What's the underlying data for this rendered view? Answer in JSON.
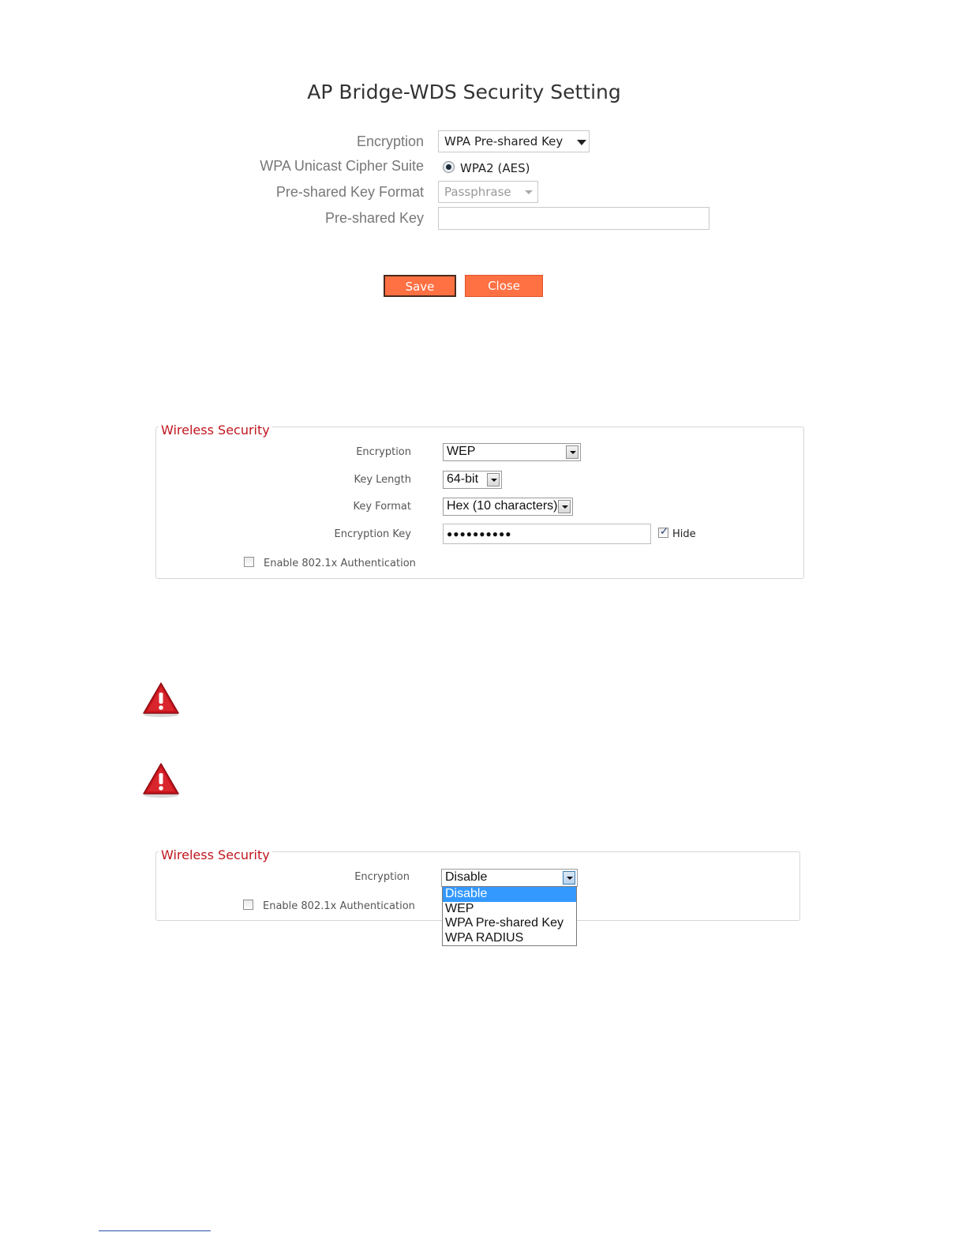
{
  "panel1": {
    "title": "AP Bridge-WDS Security Setting",
    "encryption_label": "Encryption",
    "encryption_value": "WPA Pre-shared Key",
    "cipher_label": "WPA Unicast Cipher Suite",
    "cipher_option": "WPA2 (AES)",
    "key_format_label": "Pre-shared Key Format",
    "key_format_value": "Passphrase",
    "key_label": "Pre-shared Key",
    "key_value": "",
    "save_label": "Save",
    "close_label": "Close"
  },
  "panel2": {
    "legend": "Wireless  Security",
    "encryption_label": "Encryption",
    "encryption_value": "WEP",
    "key_length_label": "Key Length",
    "key_length_value": "64-bit",
    "key_format_label": "Key Format",
    "key_format_value": "Hex (10 characters)",
    "encryption_key_label": "Encryption Key",
    "encryption_key_value": "●●●●●●●●●●",
    "hide_label": "Hide",
    "hide_checked": true,
    "auth_label": "Enable 802.1x Authentication",
    "auth_checked": false
  },
  "panel3": {
    "legend": "Wireless  Security",
    "encryption_label": "Encryption",
    "encryption_value": "Disable",
    "options": [
      "Disable",
      "WEP",
      "WPA Pre-shared Key",
      "WPA RADIUS"
    ],
    "selected_option": "Disable",
    "auth_label": "Enable 802.1x Authentication",
    "auth_checked": false
  },
  "icons": {
    "warning_1": "warning-icon",
    "warning_2": "warning-icon"
  },
  "colors": {
    "accent_button": "#ff7043",
    "legend_red": "#c0161f",
    "selection_blue": "#3399ff",
    "warning_red": "#c8141c"
  }
}
